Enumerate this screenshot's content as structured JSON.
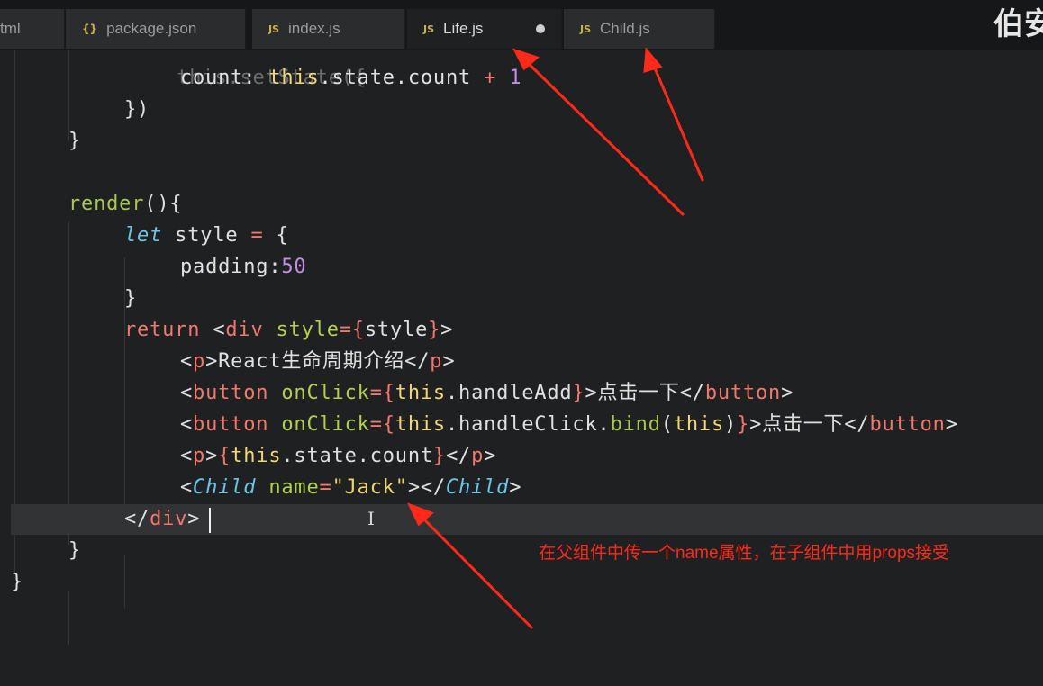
{
  "tabs": [
    {
      "label": "tml",
      "icon": "none",
      "active": false
    },
    {
      "label": "package.json",
      "icon": "json-braces-icon",
      "icon_glyph": "{}",
      "active": false
    },
    {
      "label": "index.js",
      "icon": "js-file-icon",
      "icon_glyph": "JS",
      "active": false
    },
    {
      "label": "Life.js",
      "icon": "js-file-icon",
      "icon_glyph": "JS",
      "active": true,
      "modified": true
    },
    {
      "label": "Child.js",
      "icon": "js-file-icon",
      "icon_glyph": "JS",
      "active": false
    }
  ],
  "corner_title": "伯安",
  "code": {
    "l0": {
      "a": "this.setState({"
    },
    "l1": {
      "a": "count: ",
      "b": "this",
      "c": ".state.count ",
      "d": "+",
      "e": " ",
      "f": "1"
    },
    "l2": {
      "a": "})"
    },
    "l3": {
      "a": "}"
    },
    "l4": {
      "a": "render",
      "b": "(){"
    },
    "l5": {
      "a": "let",
      "b": " style ",
      "c": "=",
      "d": " {"
    },
    "l6": {
      "a": "padding:",
      "b": "50"
    },
    "l7": {
      "a": "}"
    },
    "l8": {
      "a": "return",
      "b": " <",
      "c": "div",
      "d": " style",
      "e": "={",
      "f": "style",
      "g": "}",
      "h": ">"
    },
    "l9": {
      "a": "<",
      "b": "p",
      "c": ">React生命周期介绍</",
      "d": "p",
      "e": ">"
    },
    "l10": {
      "a": "<",
      "b": "button",
      "c": " onClick",
      "d": "={",
      "e": "this",
      "f": ".handleAdd",
      "g": "}",
      "h": ">点击一下</",
      "i": "button",
      "j": ">"
    },
    "l11": {
      "a": "<",
      "b": "button",
      "c": " onClick",
      "d": "={",
      "e": "this",
      "f": ".handleClick.",
      "g": "bind",
      "h": "(",
      "i": "this",
      "j": ")",
      "k": "}",
      "l": ">点击一下</",
      "m": "button",
      "n": ">"
    },
    "l12": {
      "a": "<",
      "b": "p",
      "c": ">",
      "d": "{",
      "e": "this",
      "f": ".state.count",
      "g": "}",
      "h": "</",
      "i": "p",
      "j": ">"
    },
    "l13": {
      "a": "<",
      "b": "Child",
      "c": " name",
      "d": "=",
      "e": "\"Jack\"",
      "f": "></",
      "g": "Child",
      "h": ">"
    },
    "l14": {
      "a": "</",
      "b": "div",
      "c": ">"
    },
    "l15": {
      "a": "}"
    },
    "l16": {
      "a": "}"
    }
  },
  "annotation": "在父组件中传一个name属性，在子组件中用props接受",
  "colors": {
    "arrow": "#ff2a1a",
    "background": "#1f2021",
    "keyword": "#f0786d",
    "this": "#f1d775",
    "function": "#a9c64f",
    "number": "#c28ee8",
    "component": "#6cc5e8"
  }
}
